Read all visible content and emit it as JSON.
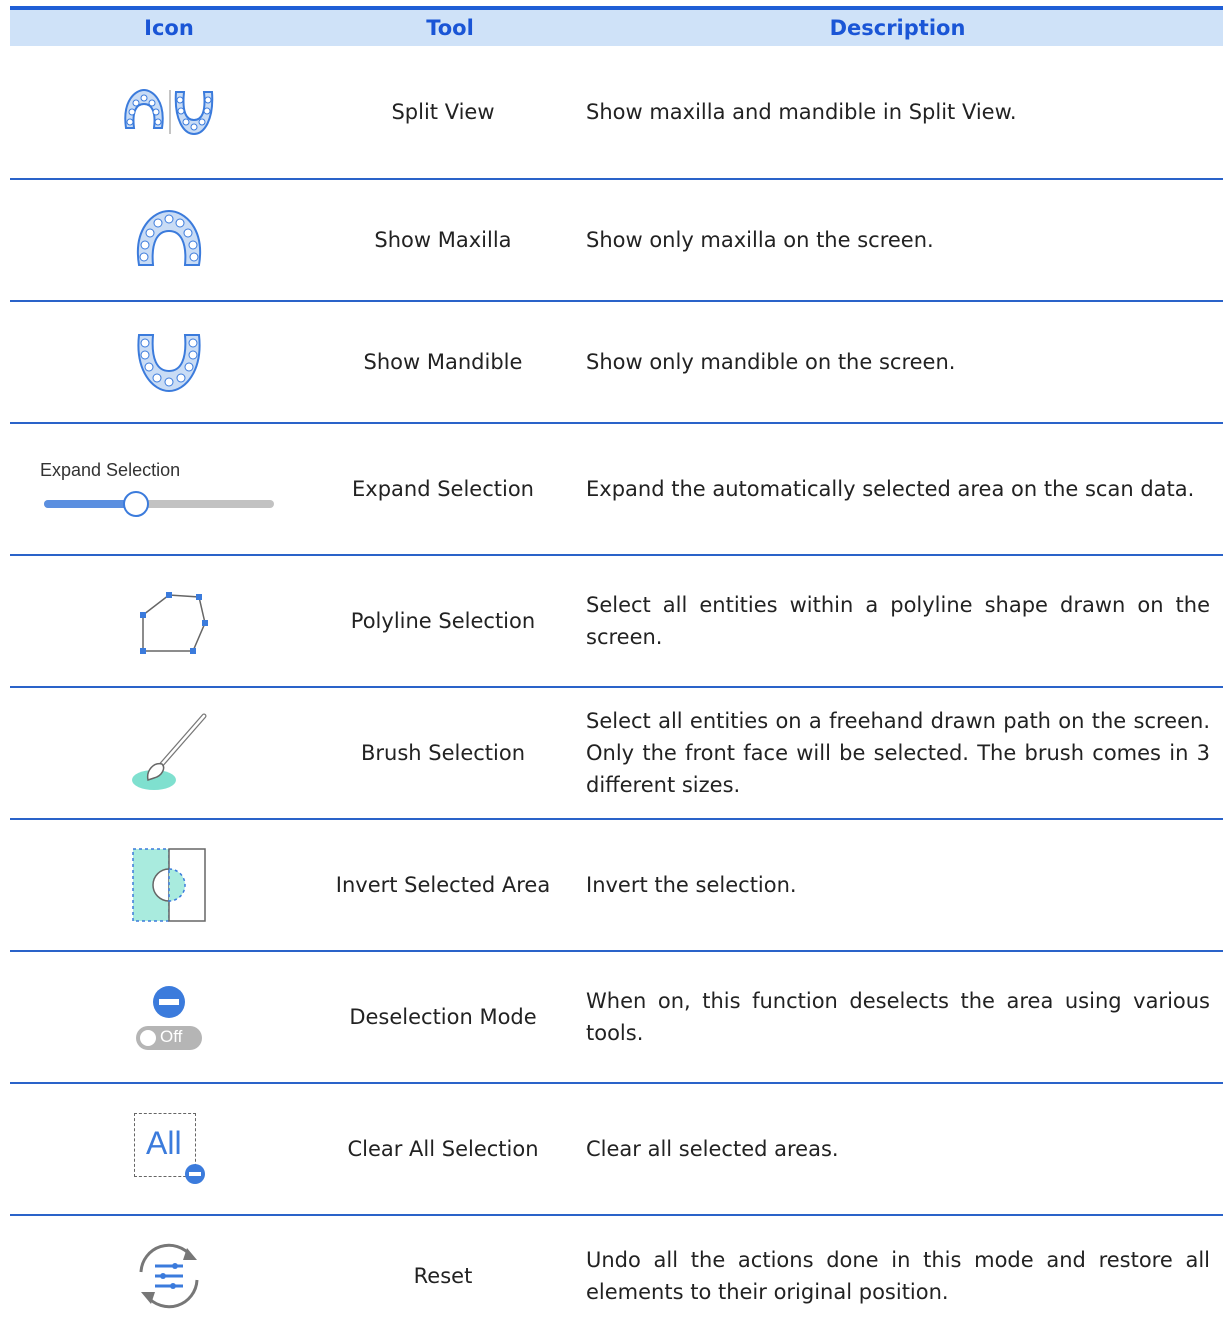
{
  "header": {
    "icon": "Icon",
    "tool": "Tool",
    "description": "Description"
  },
  "colors": {
    "accent": "#1f5fd6",
    "header_bg": "#cfe2f8",
    "icon_blue": "#3b7bdc",
    "teal": "#7fe0cf"
  },
  "rows": [
    {
      "icon": "split-view-icon",
      "tool": "Split View",
      "description": "Show maxilla and mandible in Split View."
    },
    {
      "icon": "maxilla-icon",
      "tool": "Show Maxilla",
      "description": "Show only maxilla on the screen."
    },
    {
      "icon": "mandible-icon",
      "tool": "Show Mandible",
      "description": "Show only mandible on the screen."
    },
    {
      "icon": "expand-selection-slider-icon",
      "icon_label": "Expand Selection",
      "slider_level": 0.4,
      "tool": "Expand Selection",
      "description": "Expand the automatically selected area on the scan data."
    },
    {
      "icon": "polyline-icon",
      "tool": "Polyline Selection",
      "description": "Select all entities within a polyline shape drawn on the screen."
    },
    {
      "icon": "brush-icon",
      "tool": "Brush Selection",
      "description": "Select all entities on a freehand drawn path on the screen. Only the front face will be selected. The brush comes in 3 different sizes."
    },
    {
      "icon": "invert-selection-icon",
      "tool": "Invert Selected Area",
      "description": "Invert the selection."
    },
    {
      "icon": "deselection-toggle-icon",
      "toggle_label": "Off",
      "tool": "Deselection Mode",
      "description": "When on, this function deselects the area using various tools."
    },
    {
      "icon": "clear-all-icon",
      "icon_label": "All",
      "tool": "Clear All Selection",
      "description": "Clear all selected areas."
    },
    {
      "icon": "reset-icon",
      "tool": "Reset",
      "description": "Undo all the actions done in this mode and restore all elements to their original position."
    }
  ]
}
